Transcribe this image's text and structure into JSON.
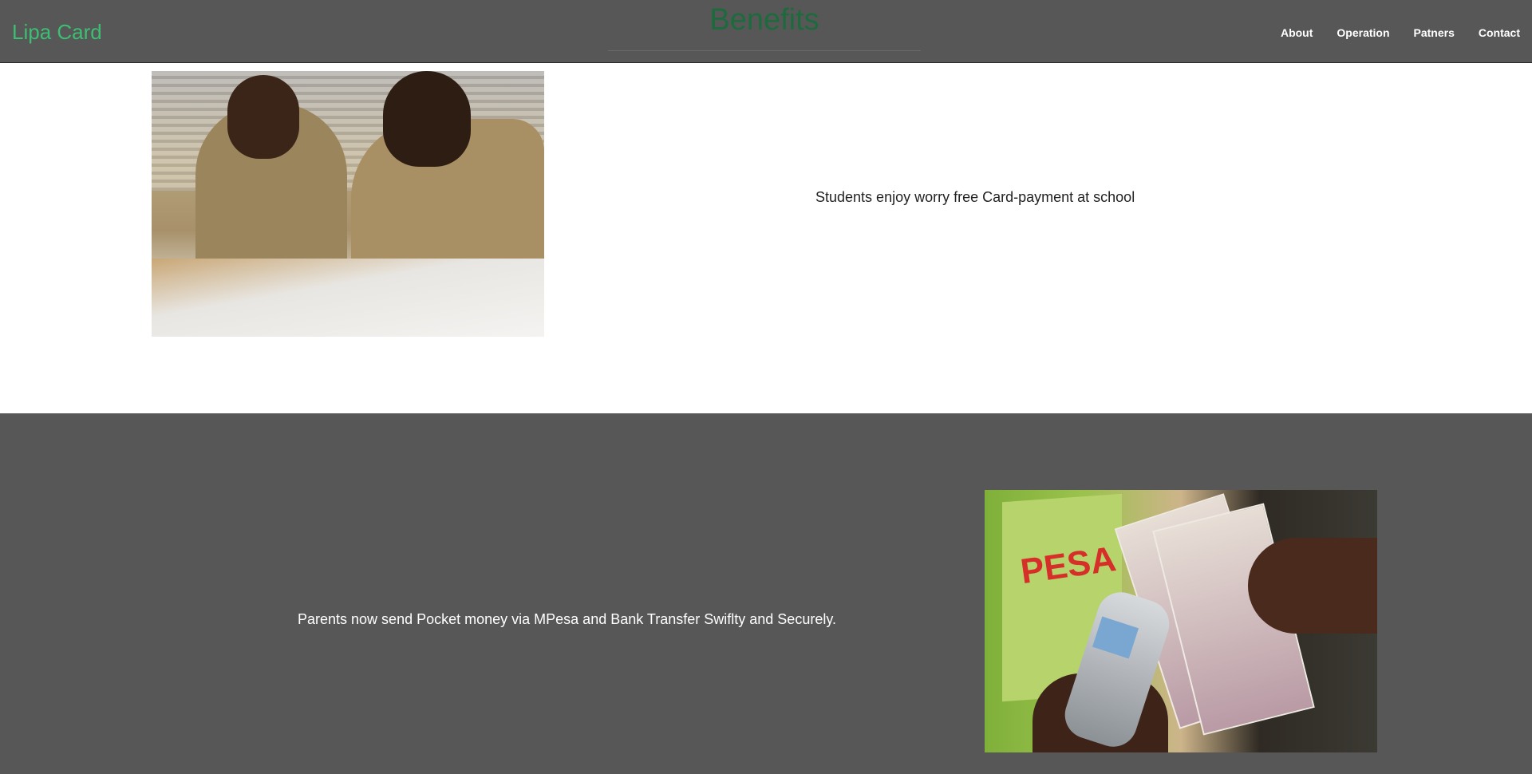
{
  "navbar": {
    "brand": "Lipa Card",
    "links": [
      "About",
      "Operation",
      "Patners",
      "Contact"
    ]
  },
  "page_title": "Benefits",
  "benefits": [
    {
      "caption": "Students enjoy worry free Card-payment at school",
      "image": "students-writing-photo"
    },
    {
      "caption": "Parents now send Pocket money via MPesa and Bank Transfer Swiflty and Securely.",
      "image": "mobile-money-photo",
      "image_text": "PESA"
    }
  ],
  "colors": {
    "navbar_bg": "#575757",
    "brand": "#3dbf73",
    "title": "#1d6b3d",
    "dark_section_bg": "#575757"
  }
}
